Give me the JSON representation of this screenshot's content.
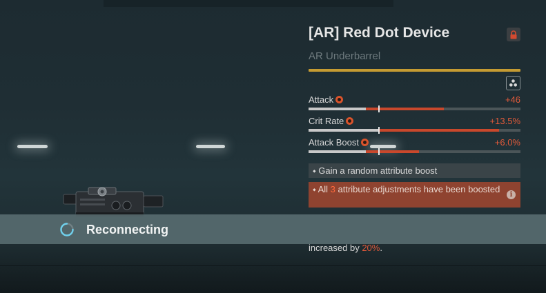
{
  "item": {
    "title": "[AR] Red Dot Device",
    "subtitle": "AR Underbarrel",
    "icons": {
      "lock": "lock-icon",
      "slots": "attribute-slots-icon"
    },
    "rarity_color": "#c59b32"
  },
  "stats": [
    {
      "name": "Attack",
      "value": "+46",
      "base_fraction": 0.27,
      "boosted_fraction": 0.64,
      "marker_fraction": 0.33
    },
    {
      "name": "Crit Rate",
      "value": "+13.5%",
      "base_fraction": 0.33,
      "boosted_fraction": 0.9,
      "marker_fraction": 0.33
    },
    {
      "name": "Attack Boost",
      "value": "+6.0%",
      "base_fraction": 0.27,
      "boosted_fraction": 0.52,
      "marker_fraction": 0.33
    }
  ],
  "boosts": {
    "random": "Gain a random attribute boost",
    "all_prefix": "All ",
    "all_count": "3",
    "all_suffix": " attribute adjustments have been boosted"
  },
  "description": {
    "prefix": "increased by ",
    "percent": "20%",
    "suffix": "."
  },
  "banner": {
    "text": "Reconnecting",
    "icon": "loading-spinner-icon"
  },
  "colors": {
    "stat_value": "#e05a3a",
    "boost_highlight": "#8f4330",
    "banner": "#62767a"
  }
}
